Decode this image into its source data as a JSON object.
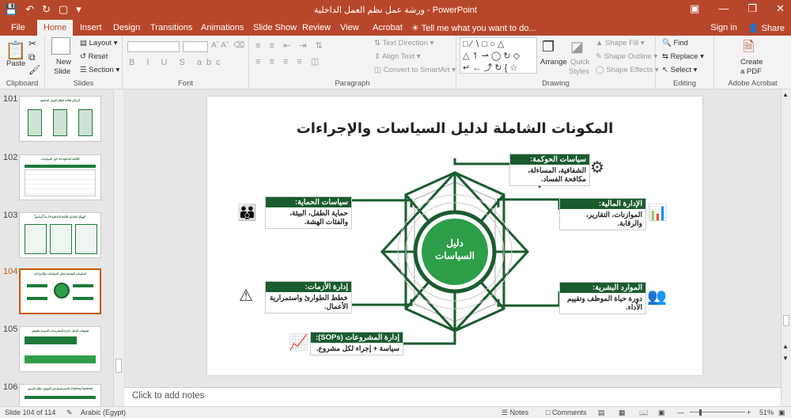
{
  "app": {
    "window_title": "ورشة عمل نظم العمل الداخلية - PowerPoint",
    "qat_icons": [
      "save-icon",
      "undo-icon",
      "redo-icon",
      "present-icon",
      "more-icon"
    ],
    "window_controls": [
      "ribbon-display-icon",
      "minimize-icon",
      "restore-icon",
      "close-icon"
    ]
  },
  "tabs": [
    "File",
    "Home",
    "Insert",
    "Design",
    "Transitions",
    "Animations",
    "Slide Show",
    "Review",
    "View",
    "Acrobat"
  ],
  "active_tab": "Home",
  "tell_me": "Tell me what you want to do...",
  "account": {
    "sign_in": "Sign in",
    "share": "Share"
  },
  "ribbon": {
    "clipboard": {
      "label": "Clipboard",
      "paste": "Paste"
    },
    "slides": {
      "label": "Slides",
      "new_slide_1": "New",
      "new_slide_2": "Slide",
      "layout": "Layout",
      "reset": "Reset",
      "section": "Section"
    },
    "font": {
      "label": "Font"
    },
    "paragraph": {
      "label": "Paragraph",
      "text_direction": "Text Direction",
      "align_text": "Align Text",
      "smartart": "Convert to SmartArt"
    },
    "drawing": {
      "label": "Drawing",
      "arrange": "Arrange",
      "quick_styles_1": "Quick",
      "quick_styles_2": "Styles",
      "shape_fill": "Shape Fill",
      "shape_outline": "Shape Outline",
      "shape_effects": "Shape Effects"
    },
    "editing": {
      "label": "Editing",
      "find": "Find",
      "replace": "Replace",
      "select": "Select"
    },
    "acrobat": {
      "label": "Adobe Acrobat",
      "create_pdf_1": "Create",
      "create_pdf_2": "a PDF"
    }
  },
  "thumbnails": [
    {
      "num": "101",
      "title": "الركائز الثلاث لنظام العمل الداخلية"
    },
    {
      "num": "102",
      "title": "اللائحة الداخلية vs دليل السياسات"
    },
    {
      "num": "103",
      "title": "الهيكل الشامل للائحة الداخلية 15 بنداً أساسياً"
    },
    {
      "num": "104",
      "title": "المكونات الشاملة لدليل السياسات والإجراءات",
      "selected": true
    },
    {
      "num": "105",
      "title": "تطبيقات الدليل: إدارة المشروعات النموذج تطبيقي"
    },
    {
      "num": "106",
      "title": "(Coding System) الاستراتيجية في التوثيق: نظام الترميز"
    }
  ],
  "slide": {
    "title": "المكونات الشاملة لدليل السياسات والإجراءات",
    "hub_line1": "دليل",
    "hub_line2": "السياسات",
    "cards": {
      "governance": {
        "head": "سياسات الحوكمة:",
        "body": "الشفافية، المساءلة، مكافحة الفساد.",
        "icon": "gears-icon"
      },
      "finance": {
        "head": "الإدارة المالية:",
        "body": "الموازنات، التقارير، والرقابة.",
        "icon": "calculator-chart-icon"
      },
      "hr": {
        "head": "الموارد البشرية:",
        "body": "دورة حياة الموظف وتقييم الأداء.",
        "icon": "people-cycle-icon"
      },
      "projects": {
        "head": "إدارة المشروعات (SOPs):",
        "body": "سياسة + إجراء لكل مشروع.",
        "icon": "project-board-icon"
      },
      "crisis": {
        "head": "إدارة الأزمات:",
        "body": "خطط الطوارئ واستمرارية الأعمال.",
        "icon": "shield-alert-icon"
      },
      "protection": {
        "head": "سياسات الحماية:",
        "body": "حماية الطفل، البيئة، والفئات الهشة.",
        "icon": "protection-people-icon"
      }
    }
  },
  "notes_placeholder": "Click to add notes",
  "status": {
    "slide_info": "Slide 104 of 114",
    "language": "Arabic (Egypt)",
    "notes": "Notes",
    "comments": "Comments",
    "zoom": "51%"
  },
  "colors": {
    "accent": "#b7472a",
    "dark_green": "#1a5c2e",
    "green": "#2e9e48"
  }
}
